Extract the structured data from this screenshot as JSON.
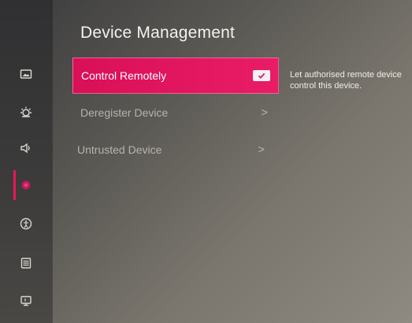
{
  "page": {
    "title": "Device Management"
  },
  "sidebar": {
    "items": [
      {
        "icon": "picture-icon"
      },
      {
        "icon": "brightness-icon"
      },
      {
        "icon": "speaker-icon"
      },
      {
        "icon": "network-icon",
        "active": true
      },
      {
        "icon": "accessibility-icon"
      },
      {
        "icon": "list-icon"
      },
      {
        "icon": "monitor-icon"
      }
    ]
  },
  "menu": {
    "items": [
      {
        "label": "Control Remotely",
        "selected": true,
        "toggle": "checked"
      },
      {
        "label": "Deregister Device",
        "chevron": ">"
      },
      {
        "label": "Untrusted Device",
        "chevron": ">"
      }
    ]
  },
  "help": {
    "text": "Let authorised remote device control this device."
  },
  "colors": {
    "accent": "#e8175d",
    "text": "#f2f2f2",
    "dim_text": "#b7b3ad"
  }
}
